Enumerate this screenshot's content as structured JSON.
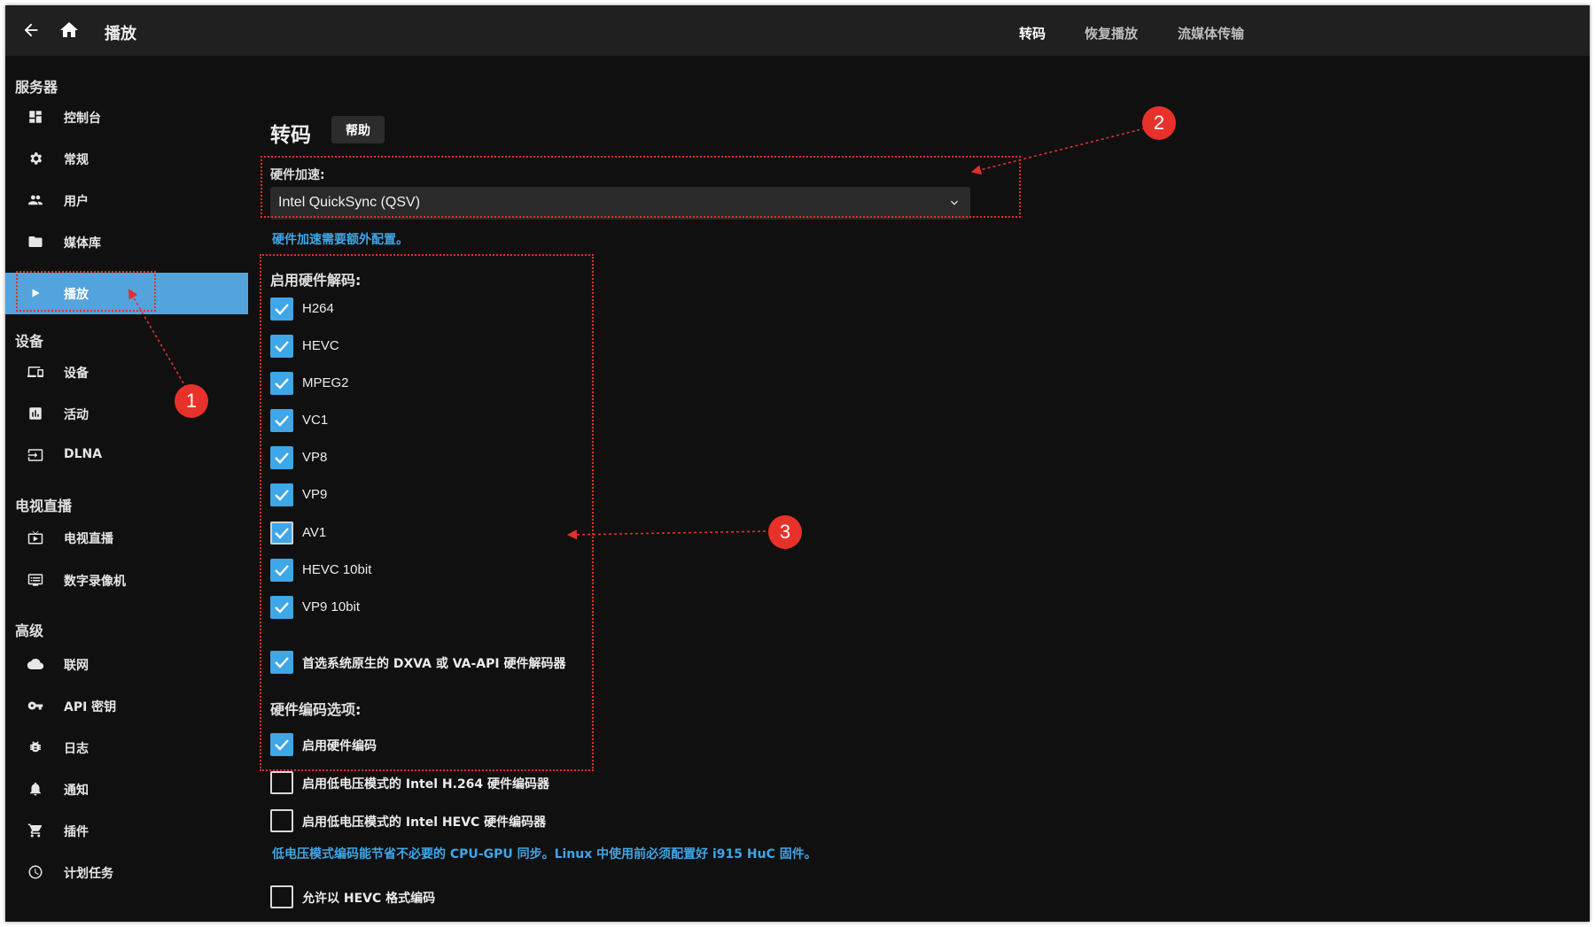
{
  "header": {
    "title": "播放",
    "tabs": [
      {
        "label": "转码",
        "active": true
      },
      {
        "label": "恢复播放",
        "active": false
      },
      {
        "label": "流媒体传输",
        "active": false
      }
    ]
  },
  "sidebar": {
    "sections": [
      {
        "title": "服务器",
        "items": [
          {
            "label": "控制台",
            "icon": "dashboard-icon"
          },
          {
            "label": "常规",
            "icon": "gear-icon"
          },
          {
            "label": "用户",
            "icon": "people-icon"
          },
          {
            "label": "媒体库",
            "icon": "folder-icon"
          },
          {
            "label": "播放",
            "icon": "play-icon",
            "active": true
          }
        ]
      },
      {
        "title": "设备",
        "items": [
          {
            "label": "设备",
            "icon": "devices-icon"
          },
          {
            "label": "活动",
            "icon": "activity-icon"
          },
          {
            "label": "DLNA",
            "icon": "input-icon"
          }
        ]
      },
      {
        "title": "电视直播",
        "items": [
          {
            "label": "电视直播",
            "icon": "live-tv-icon"
          },
          {
            "label": "数字录像机",
            "icon": "dvr-icon"
          }
        ]
      },
      {
        "title": "高级",
        "items": [
          {
            "label": "联网",
            "icon": "cloud-icon"
          },
          {
            "label": "API 密钥",
            "icon": "key-icon"
          },
          {
            "label": "日志",
            "icon": "bug-icon"
          },
          {
            "label": "通知",
            "icon": "bell-icon"
          },
          {
            "label": "插件",
            "icon": "cart-icon"
          },
          {
            "label": "计划任务",
            "icon": "clock-icon"
          }
        ]
      }
    ]
  },
  "main": {
    "title": "转码",
    "help_label": "帮助",
    "hw_accel_label": "硬件加速:",
    "hw_accel_value": "Intel QuickSync (QSV)",
    "hw_accel_hint": "硬件加速需要额外配置。",
    "decode_label": "启用硬件解码:",
    "decoders": [
      {
        "label": "H264",
        "checked": true
      },
      {
        "label": "HEVC",
        "checked": true
      },
      {
        "label": "MPEG2",
        "checked": true
      },
      {
        "label": "VC1",
        "checked": true
      },
      {
        "label": "VP8",
        "checked": true
      },
      {
        "label": "VP9",
        "checked": true
      },
      {
        "label": "AV1",
        "checked": true
      },
      {
        "label": "HEVC 10bit",
        "checked": true
      },
      {
        "label": "VP9 10bit",
        "checked": true
      }
    ],
    "prefer_native_label": "首选系统原生的 DXVA 或 VA-API 硬件解码器",
    "prefer_native_checked": true,
    "encode_label": "硬件编码选项:",
    "enable_hw_encode_label": "启用硬件编码",
    "enable_hw_encode_checked": true,
    "low_power_h264_label": "启用低电压模式的 Intel H.264 硬件编码器",
    "low_power_h264_checked": false,
    "low_power_hevc_label": "启用低电压模式的 Intel HEVC 硬件编码器",
    "low_power_hevc_checked": false,
    "low_power_hint": "低电压模式编码能节省不必要的 CPU-GPU 同步。Linux 中使用前必须配置好 i915 HuC 固件。",
    "allow_hevc_label": "允许以 HEVC 格式编码",
    "allow_hevc_checked": false
  },
  "annotations": [
    "1",
    "2",
    "3"
  ],
  "colors": {
    "accent": "#53a3dc",
    "link": "#3fa6e8",
    "annotation": "#e8312a",
    "background": "#101010",
    "header": "#202020"
  }
}
